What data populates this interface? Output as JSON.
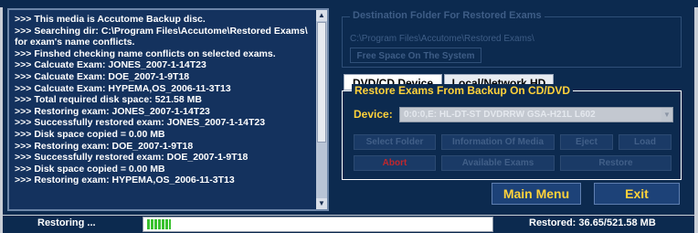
{
  "log": {
    "lines": [
      ">>> This media is Accutome Backup disc.",
      ">>> Searching dir: C:\\Program Files\\Accutome\\Restored Exams\\ for exam's name conflicts.",
      ">>> Finshed checking name conflicts on selected exams.",
      ">>> Calcuate Exam: JONES_2007-1-14T23",
      ">>> Calcuate Exam: DOE_2007-1-9T18",
      ">>> Calcuate Exam: HYPEMA,OS_2006-11-3T13",
      ">>> Total required disk space: 521.58 MB",
      ">>> Restoring exam: JONES_2007-1-14T23",
      ">>> Successfully restored exam: JONES_2007-1-14T23",
      ">>> Disk space copied = 0.00 MB",
      ">>> Restoring exam: DOE_2007-1-9T18",
      ">>> Successfully restored exam: DOE_2007-1-9T18",
      ">>> Disk space copied = 0.00 MB",
      ">>> Restoring exam: HYPEMA,OS_2006-11-3T13"
    ]
  },
  "destination": {
    "legend": "Destination Folder For Restored Exams",
    "path": "C:\\Program Files\\Accutome\\Restored Exams\\",
    "free_space_label": "Free Space On The System"
  },
  "tabs": {
    "dvd": "DVD/CD Device",
    "local": "Local/Network HD"
  },
  "restore": {
    "legend": "Restore Exams From Backup On CD/DVD",
    "device_label": "Device:",
    "device_value": "0:0:0,E: HL-DT-ST DVDRRW GSA-H21L  L602",
    "buttons": {
      "select_folder": "Select Folder",
      "info_media": "Information Of Media",
      "eject": "Eject",
      "load": "Load",
      "abort": "Abort",
      "available_exams": "Available Exams",
      "restore": "Restore"
    }
  },
  "nav": {
    "main_menu": "Main Menu",
    "exit": "Exit"
  },
  "status": {
    "text": "Restoring ...",
    "progress_fraction": 0.07,
    "restored": "Restored: 36.65/521.58 MB"
  },
  "colors": {
    "background": "#0c2a4f",
    "accent": "#ffd23a",
    "progress": "#39c12e"
  }
}
